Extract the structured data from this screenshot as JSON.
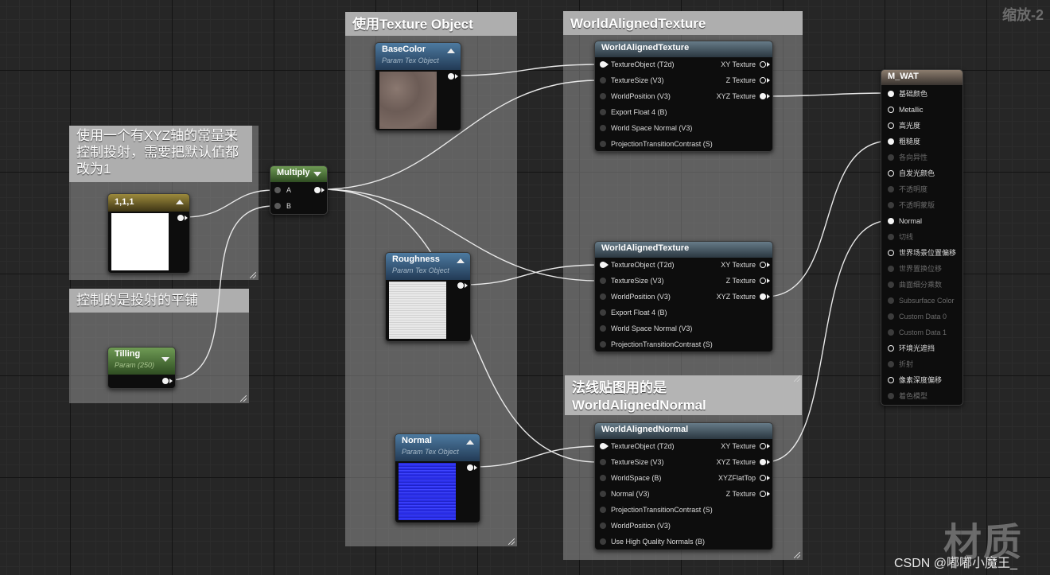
{
  "zoom_label": "缩放-2",
  "watermark": {
    "text": "材质",
    "credit": "CSDN @嘟嘟小魔王_"
  },
  "comments": {
    "xyz_note": "使用一个有XYZ轴的常量来控制投射，需要把默认值都改为1",
    "tiling_note": "控制的是投射的平铺",
    "texobj_note": "使用Texture Object",
    "wat_note": "WorldAlignedTexture",
    "normal_note": "法线贴图用的是WorldAlignedNormal"
  },
  "nodes": {
    "const": {
      "title": "1,1,1"
    },
    "tilling": {
      "title": "Tilling",
      "subtitle": "Param (250)"
    },
    "multiply": {
      "title": "Multiply",
      "pins": [
        "A",
        "B"
      ]
    },
    "basecolor": {
      "title": "BaseColor",
      "subtitle": "Param Tex Object"
    },
    "roughness": {
      "title": "Roughness",
      "subtitle": "Param Tex Object"
    },
    "normal": {
      "title": "Normal",
      "subtitle": "Param Tex Object"
    },
    "wat1": {
      "title": "WorldAlignedTexture",
      "inputs": [
        "TextureObject (T2d)",
        "TextureSize (V3)",
        "WorldPosition (V3)",
        "Export Float 4 (B)",
        "World Space Normal (V3)",
        "ProjectionTransitionContrast (S)"
      ],
      "outputs": [
        "XY Texture",
        "Z Texture",
        "XYZ Texture"
      ]
    },
    "wat2": {
      "title": "WorldAlignedTexture",
      "inputs": [
        "TextureObject (T2d)",
        "TextureSize (V3)",
        "WorldPosition (V3)",
        "Export Float 4 (B)",
        "World Space Normal (V3)",
        "ProjectionTransitionContrast (S)"
      ],
      "outputs": [
        "XY Texture",
        "Z Texture",
        "XYZ Texture"
      ]
    },
    "wan": {
      "title": "WorldAlignedNormal",
      "inputs": [
        "TextureObject (T2d)",
        "TextureSize (V3)",
        "WorldSpace (B)",
        "Normal (V3)",
        "ProjectionTransitionContrast (S)",
        "WorldPosition (V3)",
        "Use High Quality Normals (B)"
      ],
      "outputs": [
        "XY Texture",
        "XYZ Texture",
        "XYZFlatTop",
        "Z Texture"
      ]
    },
    "material": {
      "title": "M_WAT",
      "pins": [
        {
          "label": "基础颜色",
          "active": true
        },
        {
          "label": "Metallic",
          "active": true
        },
        {
          "label": "高光度",
          "active": true
        },
        {
          "label": "粗糙度",
          "active": true
        },
        {
          "label": "各向异性",
          "active": false
        },
        {
          "label": "自发光颜色",
          "active": true
        },
        {
          "label": "不透明度",
          "active": false
        },
        {
          "label": "不透明蒙版",
          "active": false
        },
        {
          "label": "Normal",
          "active": true
        },
        {
          "label": "切线",
          "active": false
        },
        {
          "label": "世界场景位置偏移",
          "active": true
        },
        {
          "label": "世界置换位移",
          "active": false
        },
        {
          "label": "曲面细分乘数",
          "active": false
        },
        {
          "label": "Subsurface Color",
          "active": false
        },
        {
          "label": "Custom Data 0",
          "active": false
        },
        {
          "label": "Custom Data 1",
          "active": false
        },
        {
          "label": "环境光遮挡",
          "active": true
        },
        {
          "label": "折射",
          "active": false
        },
        {
          "label": "像素深度偏移",
          "active": true
        },
        {
          "label": "着色模型",
          "active": false
        }
      ]
    }
  }
}
